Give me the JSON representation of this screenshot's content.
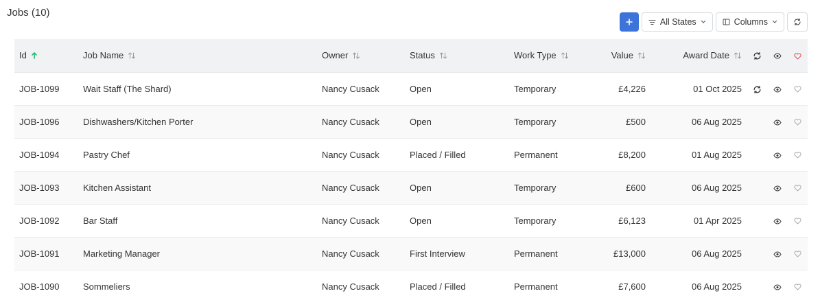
{
  "page": {
    "title": "Jobs (10)"
  },
  "toolbar": {
    "add_label": "+",
    "states_label": "All States",
    "columns_label": "Columns"
  },
  "colors": {
    "accent": "#3d74d9",
    "sort_active": "#2bb673",
    "favorite_active": "#e05260"
  },
  "columns": {
    "id": "Id",
    "job_name": "Job Name",
    "owner": "Owner",
    "status": "Status",
    "work_type": "Work Type",
    "value": "Value",
    "award_date": "Award Date"
  },
  "rows": [
    {
      "id": "JOB-1099",
      "job_name": "Wait Staff (The Shard)",
      "owner": "Nancy Cusack",
      "status": "Open",
      "work_type": "Temporary",
      "value": "£4,226",
      "award_date": "01 Oct 2025",
      "syncing": true
    },
    {
      "id": "JOB-1096",
      "job_name": "Dishwashers/Kitchen Porter",
      "owner": "Nancy Cusack",
      "status": "Open",
      "work_type": "Temporary",
      "value": "£500",
      "award_date": "06 Aug 2025",
      "syncing": false
    },
    {
      "id": "JOB-1094",
      "job_name": "Pastry Chef",
      "owner": "Nancy Cusack",
      "status": "Placed / Filled",
      "work_type": "Permanent",
      "value": "£8,200",
      "award_date": "01 Aug 2025",
      "syncing": false
    },
    {
      "id": "JOB-1093",
      "job_name": "Kitchen Assistant",
      "owner": "Nancy Cusack",
      "status": "Open",
      "work_type": "Temporary",
      "value": "£600",
      "award_date": "06 Aug 2025",
      "syncing": false
    },
    {
      "id": "JOB-1092",
      "job_name": "Bar Staff",
      "owner": "Nancy Cusack",
      "status": "Open",
      "work_type": "Temporary",
      "value": "£6,123",
      "award_date": "01 Apr 2025",
      "syncing": false
    },
    {
      "id": "JOB-1091",
      "job_name": "Marketing Manager",
      "owner": "Nancy Cusack",
      "status": "First Interview",
      "work_type": "Permanent",
      "value": "£13,000",
      "award_date": "06 Aug 2025",
      "syncing": false
    },
    {
      "id": "JOB-1090",
      "job_name": "Sommeliers",
      "owner": "Nancy Cusack",
      "status": "Placed / Filled",
      "work_type": "Permanent",
      "value": "£7,600",
      "award_date": "06 Aug 2025",
      "syncing": false
    }
  ]
}
